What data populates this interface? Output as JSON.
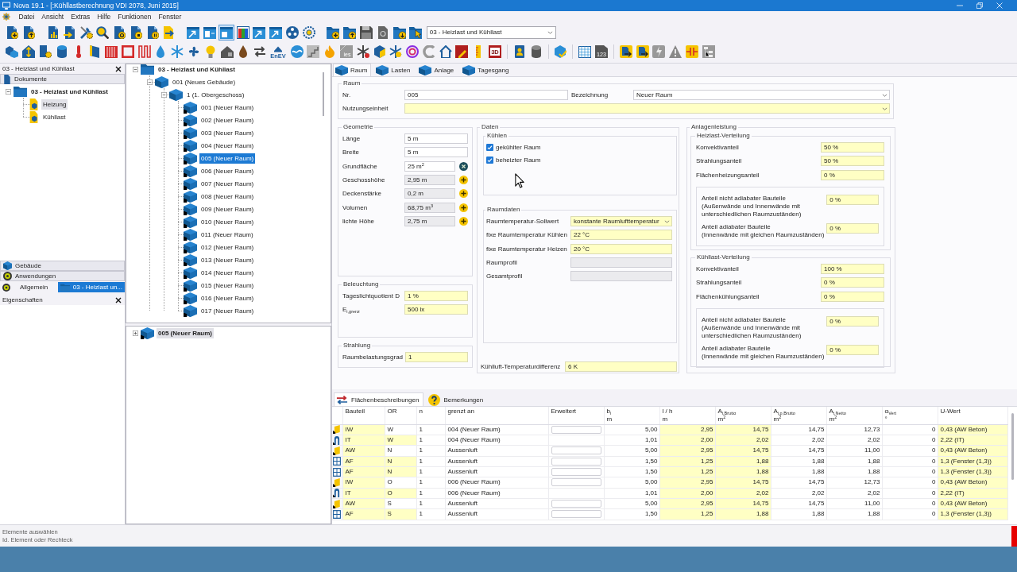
{
  "window": {
    "title": "Nova 19.1 - [:Kühllastberechnung VDI 2078, Juni 2015]"
  },
  "menu": [
    "Datei",
    "Ansicht",
    "Extras",
    "Hilfe",
    "Funktionen",
    "Fenster"
  ],
  "toolbar_1": {
    "buttons": [
      {
        "pressed": false
      },
      {
        "pressed": false
      },
      {
        "pressed": false
      },
      {
        "pressed": false
      },
      {
        "pressed": false
      },
      {
        "pressed": false
      },
      {
        "pressed": false
      },
      {
        "pressed": false
      },
      {
        "pressed": false
      },
      {
        "pressed": false
      },
      {
        "pressed": false
      },
      {
        "pressed": false
      },
      {
        "pressed": true
      },
      {
        "pressed": false
      },
      {
        "pressed": false
      },
      {
        "pressed": false
      },
      {
        "pressed": false
      },
      {
        "pressed": false
      },
      {
        "pressed": false
      },
      {
        "pressed": false
      },
      {
        "pressed": false
      },
      {
        "pressed": false
      },
      {
        "pressed": false
      },
      {
        "pressed": false
      }
    ],
    "dropdown": {
      "value": "03 - Heizlast und Kühllast"
    }
  },
  "toolbar_2": {
    "icon_texts": [
      "EnEV",
      "ies",
      "3D",
      "123"
    ]
  },
  "documents_panel": {
    "title": "03 - Heizlast und Kühllast",
    "section": "Dokumente",
    "tree": [
      {
        "kind": "project",
        "label": "03 - Heizlast und Kühllast",
        "expanded": true,
        "selected": false,
        "children": [
          {
            "kind": "document",
            "label": "Heizung",
            "selected": true
          },
          {
            "kind": "document",
            "label": "Kühllast",
            "selected": false
          }
        ]
      }
    ],
    "sections": [
      "Gebäude",
      "Anwendungen"
    ],
    "tabs": [
      {
        "label": "Allgemein",
        "selected": false
      },
      {
        "label": "03 - Heizlast un...",
        "selected": true
      }
    ]
  },
  "properties_panel": {
    "title": "Eigenschaften"
  },
  "building_tree": [
    {
      "kind": "project",
      "label": "03 - Heizlast und Kühllast",
      "expanded": true,
      "selected": false,
      "children": [
        {
          "kind": "building",
          "label": "001 (Neues Gebäude)",
          "expanded": true,
          "selected": false,
          "children": [
            {
              "kind": "storey",
              "label": "1 (1. Obergeschoss)",
              "expanded": true,
              "selected": false,
              "children": [
                {
                  "kind": "room",
                  "label": "001 (Neuer Raum)",
                  "selected": false
                },
                {
                  "kind": "room",
                  "label": "002 (Neuer Raum)",
                  "selected": false
                },
                {
                  "kind": "room",
                  "label": "003 (Neuer Raum)",
                  "selected": false
                },
                {
                  "kind": "room",
                  "label": "004 (Neuer Raum)",
                  "selected": false
                },
                {
                  "kind": "room",
                  "label": "005 (Neuer Raum)",
                  "selected": true
                },
                {
                  "kind": "room",
                  "label": "006 (Neuer Raum)",
                  "selected": false
                },
                {
                  "kind": "room",
                  "label": "007 (Neuer Raum)",
                  "selected": false
                },
                {
                  "kind": "room",
                  "label": "008 (Neuer Raum)",
                  "selected": false
                },
                {
                  "kind": "room",
                  "label": "009 (Neuer Raum)",
                  "selected": false
                },
                {
                  "kind": "room",
                  "label": "010 (Neuer Raum)",
                  "selected": false
                },
                {
                  "kind": "room",
                  "label": "011 (Neuer Raum)",
                  "selected": false
                },
                {
                  "kind": "room",
                  "label": "012 (Neuer Raum)",
                  "selected": false
                },
                {
                  "kind": "room",
                  "label": "013 (Neuer Raum)",
                  "selected": false
                },
                {
                  "kind": "room",
                  "label": "014 (Neuer Raum)",
                  "selected": false
                },
                {
                  "kind": "room",
                  "label": "015 (Neuer Raum)",
                  "selected": false
                },
                {
                  "kind": "room",
                  "label": "016 (Neuer Raum)",
                  "selected": false
                },
                {
                  "kind": "room",
                  "label": "017 (Neuer Raum)",
                  "selected": false
                }
              ]
            }
          ]
        }
      ]
    }
  ],
  "detail_tree": [
    {
      "kind": "room",
      "label": "005 (Neuer Raum)",
      "expanded": false,
      "selected": true
    }
  ],
  "form_tabs": [
    {
      "label": "Raum",
      "selected": true
    },
    {
      "label": "Lasten",
      "selected": false
    },
    {
      "label": "Anlage",
      "selected": false
    },
    {
      "label": "Tagesgang",
      "selected": false
    }
  ],
  "raum": {
    "title": "Raum",
    "fields": [
      {
        "label": "Nr.",
        "value": "005",
        "kind": "input"
      },
      {
        "label": "Bezeichnung",
        "value": "Neuer Raum",
        "kind": "input",
        "dropdown": true
      },
      {
        "label": "Nutzungseinheit",
        "kind": "highlighted",
        "dropdown": true
      }
    ]
  },
  "geometrie": {
    "title": "Geometrie",
    "fields": [
      {
        "label": "Länge",
        "value": "5 m",
        "kind": "input"
      },
      {
        "label": "Breite",
        "value": "5 m",
        "kind": "input"
      },
      {
        "label": "Grundfläche",
        "value": "25 m$^{2}$",
        "kind": "input",
        "button": {
          "kind": "clear"
        }
      },
      {
        "label": "Geschosshöhe",
        "value": "2,95 m",
        "kind": "readonly",
        "button": {
          "kind": "add"
        }
      },
      {
        "label": "Deckenstärke",
        "value": "0,2 m",
        "kind": "readonly",
        "button": {
          "kind": "add"
        }
      },
      {
        "label": "Volumen",
        "value": "68,75 m$^{3}$",
        "kind": "readonly",
        "button": {
          "kind": "add"
        }
      },
      {
        "label": "lichte Höhe",
        "value": "2,75 m",
        "kind": "readonly",
        "button": {
          "kind": "add"
        }
      }
    ]
  },
  "beleuchtung": {
    "title": "Beleuchtung",
    "fields": [
      {
        "label": "Tageslichtquotient D",
        "value": "1 %",
        "kind": "highlighted"
      },
      {
        "label": "E$_{i,grenz}$",
        "value": "500 lx",
        "kind": "highlighted"
      }
    ]
  },
  "strahlung": {
    "title": "Strahlung",
    "fields": [
      {
        "label": "Raumbelastungsgrad",
        "value": "1",
        "kind": "highlighted"
      }
    ]
  },
  "daten": {
    "title": "Daten",
    "kuehlen": {
      "title": "Kühlen",
      "checkboxes": [
        {
          "label": "gekühlter Raum",
          "checked": true
        },
        {
          "label": "beheizter Raum",
          "checked": true
        }
      ]
    },
    "raumdaten": {
      "title": "Raumdaten",
      "fields": [
        {
          "label": "Raumtemperatur-Sollwert",
          "value": "konstante Raumlufttemperatur",
          "kind": "highlighted",
          "dropdown": true
        },
        {
          "label": "fixe Raumtemperatur Kühlen",
          "value": "22 °C",
          "kind": "highlighted"
        },
        {
          "label": "fixe Raumtemperatur Heizen",
          "value": "20 °C",
          "kind": "highlighted"
        },
        {
          "label": "Raumprofil",
          "kind": "readonly"
        },
        {
          "label": "Gesamtprofil",
          "kind": "readonly"
        }
      ]
    },
    "fields": [
      {
        "label": "Kühlluft-Temperaturdifferenz",
        "value": "6 K",
        "kind": "highlighted"
      }
    ]
  },
  "anlagenleistung": {
    "title": "Anlagenleistung",
    "groups": [
      {
        "title": "Heizlast-Verteilung",
        "fields": [
          {
            "label": "Konvektivanteil",
            "value": "50 %",
            "kind": "highlighted"
          },
          {
            "label": "Strahlungsanteil",
            "value": "50 %",
            "kind": "highlighted"
          },
          {
            "label": "Flächenheizungsanteil",
            "value": "0 %",
            "kind": "highlighted"
          }
        ],
        "shares": [
          {
            "label": "Anteil nicht adiabater Bauteile\n(Außenwände und Innenwände mit\nunterschiedlichen Raumzuständen)",
            "value": "0 %",
            "kind": "highlighted"
          },
          {
            "label": "Anteil adiabater Bauteile\n(Innenwände mit gleichen Raumzuständen)",
            "value": "0 %",
            "kind": "highlighted"
          }
        ]
      },
      {
        "title": "Kühllast-Verteilung",
        "fields": [
          {
            "label": "Konvektivanteil",
            "value": "100 %",
            "kind": "highlighted"
          },
          {
            "label": "Strahlungsanteil",
            "value": "0 %",
            "kind": "highlighted"
          },
          {
            "label": "Flächenkühlungsanteil",
            "value": "0 %",
            "kind": "highlighted"
          }
        ],
        "shares": [
          {
            "label": "Anteil nicht adiabater Bauteile\n(Außenwände und Innenwände mit\nunterschiedlichen Raumzuständen)",
            "value": "0 %",
            "kind": "highlighted"
          },
          {
            "label": "Anteil adiabater Bauteile\n(Innenwände mit gleichen Raumzuständen)",
            "value": "0 %",
            "kind": "highlighted"
          }
        ]
      }
    ]
  },
  "bottom_tabs": [
    {
      "label": "Flächenbeschreibungen",
      "selected": true
    },
    {
      "label": "Bemerkungen",
      "selected": false
    }
  ],
  "surfaces_table": {
    "columns": [
      {
        "label": "Bauteil",
        "kind": "text"
      },
      {
        "label": "OR",
        "kind": "text"
      },
      {
        "label": "n",
        "kind": "text"
      },
      {
        "label": "grenzt an",
        "kind": "text"
      },
      {
        "label": "Erweitert",
        "kind": "box"
      },
      {
        "label": "b$_{i}$",
        "unit": "m",
        "kind": "number"
      },
      {
        "label": "l / h",
        "unit": "m",
        "kind": "number"
      },
      {
        "label": "A$_{i,Brutto}$",
        "unit": "m$^{2}$",
        "kind": "number"
      },
      {
        "label": "A$_{i,p,Brutto}$",
        "unit": "m$^{2}$",
        "kind": "number"
      },
      {
        "label": "A$_{i,Netto}$",
        "unit": "m$^{2}$",
        "kind": "number"
      },
      {
        "label": "α$_{Vert}$",
        "unit": "°",
        "kind": "number"
      },
      {
        "label": "U-Wert",
        "kind": "text"
      }
    ],
    "rows": [
      {
        "kind": "wall",
        "cells": [
          {
            "text": "IW",
            "highlighted": true
          },
          {
            "text": "W",
            "highlighted": false
          },
          {
            "text": "1",
            "highlighted": false
          },
          {
            "text": "004 (Neuer Raum)",
            "highlighted": false
          },
          {
            "box": true
          },
          {
            "text": "5,00",
            "highlighted": false
          },
          {
            "text": "2,95",
            "highlighted": true
          },
          {
            "text": "14,75",
            "highlighted": true
          },
          {
            "text": "14,75",
            "highlighted": false
          },
          {
            "text": "12,73",
            "highlighted": false
          },
          {
            "text": "0",
            "highlighted": false
          },
          {
            "text": "0,43 (AW Beton)",
            "highlighted": true
          }
        ]
      },
      {
        "kind": "door",
        "cells": [
          {
            "text": "IT",
            "highlighted": true
          },
          {
            "text": "W",
            "highlighted": true
          },
          {
            "text": "1",
            "highlighted": false
          },
          {
            "text": "004 (Neuer Raum)",
            "highlighted": false
          },
          {
            "box": false
          },
          {
            "text": "1,01",
            "highlighted": false
          },
          {
            "text": "2,00",
            "highlighted": true
          },
          {
            "text": "2,02",
            "highlighted": true
          },
          {
            "text": "2,02",
            "highlighted": false
          },
          {
            "text": "2,02",
            "highlighted": false
          },
          {
            "text": "0",
            "highlighted": false
          },
          {
            "text": "2,22 (IT)",
            "highlighted": true
          }
        ]
      },
      {
        "kind": "wall",
        "cells": [
          {
            "text": "AW",
            "highlighted": true
          },
          {
            "text": "N",
            "highlighted": false
          },
          {
            "text": "1",
            "highlighted": false
          },
          {
            "text": "Aussenluft",
            "highlighted": false
          },
          {
            "box": true
          },
          {
            "text": "5,00",
            "highlighted": false
          },
          {
            "text": "2,95",
            "highlighted": true
          },
          {
            "text": "14,75",
            "highlighted": true
          },
          {
            "text": "14,75",
            "highlighted": false
          },
          {
            "text": "11,00",
            "highlighted": false
          },
          {
            "text": "0",
            "highlighted": false
          },
          {
            "text": "0,43 (AW Beton)",
            "highlighted": true
          }
        ]
      },
      {
        "kind": "window",
        "cells": [
          {
            "text": "AF",
            "highlighted": true
          },
          {
            "text": "N",
            "highlighted": true
          },
          {
            "text": "1",
            "highlighted": false
          },
          {
            "text": "Aussenluft",
            "highlighted": false
          },
          {
            "box": true
          },
          {
            "text": "1,50",
            "highlighted": false
          },
          {
            "text": "1,25",
            "highlighted": true
          },
          {
            "text": "1,88",
            "highlighted": true
          },
          {
            "text": "1,88",
            "highlighted": false
          },
          {
            "text": "1,88",
            "highlighted": false
          },
          {
            "text": "0",
            "highlighted": false
          },
          {
            "text": "1,3 (Fenster (1,3))",
            "highlighted": true
          }
        ]
      },
      {
        "kind": "window",
        "cells": [
          {
            "text": "AF",
            "highlighted": true
          },
          {
            "text": "N",
            "highlighted": true
          },
          {
            "text": "1",
            "highlighted": false
          },
          {
            "text": "Aussenluft",
            "highlighted": false
          },
          {
            "box": true
          },
          {
            "text": "1,50",
            "highlighted": false
          },
          {
            "text": "1,25",
            "highlighted": true
          },
          {
            "text": "1,88",
            "highlighted": true
          },
          {
            "text": "1,88",
            "highlighted": false
          },
          {
            "text": "1,88",
            "highlighted": false
          },
          {
            "text": "0",
            "highlighted": false
          },
          {
            "text": "1,3 (Fenster (1,3))",
            "highlighted": true
          }
        ]
      },
      {
        "kind": "wall",
        "cells": [
          {
            "text": "IW",
            "highlighted": true
          },
          {
            "text": "O",
            "highlighted": false
          },
          {
            "text": "1",
            "highlighted": false
          },
          {
            "text": "006 (Neuer Raum)",
            "highlighted": false
          },
          {
            "box": true
          },
          {
            "text": "5,00",
            "highlighted": false
          },
          {
            "text": "2,95",
            "highlighted": true
          },
          {
            "text": "14,75",
            "highlighted": true
          },
          {
            "text": "14,75",
            "highlighted": false
          },
          {
            "text": "12,73",
            "highlighted": false
          },
          {
            "text": "0",
            "highlighted": false
          },
          {
            "text": "0,43 (AW Beton)",
            "highlighted": true
          }
        ]
      },
      {
        "kind": "door",
        "cells": [
          {
            "text": "IT",
            "highlighted": true
          },
          {
            "text": "O",
            "highlighted": true
          },
          {
            "text": "1",
            "highlighted": false
          },
          {
            "text": "006 (Neuer Raum)",
            "highlighted": false
          },
          {
            "box": false
          },
          {
            "text": "1,01",
            "highlighted": false
          },
          {
            "text": "2,00",
            "highlighted": true
          },
          {
            "text": "2,02",
            "highlighted": true
          },
          {
            "text": "2,02",
            "highlighted": false
          },
          {
            "text": "2,02",
            "highlighted": false
          },
          {
            "text": "0",
            "highlighted": false
          },
          {
            "text": "2,22 (IT)",
            "highlighted": true
          }
        ]
      },
      {
        "kind": "wall",
        "cells": [
          {
            "text": "AW",
            "highlighted": true
          },
          {
            "text": "S",
            "highlighted": false
          },
          {
            "text": "1",
            "highlighted": false
          },
          {
            "text": "Aussenluft",
            "highlighted": false
          },
          {
            "box": true
          },
          {
            "text": "5,00",
            "highlighted": false
          },
          {
            "text": "2,95",
            "highlighted": true
          },
          {
            "text": "14,75",
            "highlighted": true
          },
          {
            "text": "14,75",
            "highlighted": false
          },
          {
            "text": "11,00",
            "highlighted": false
          },
          {
            "text": "0",
            "highlighted": false
          },
          {
            "text": "0,43 (AW Beton)",
            "highlighted": true
          }
        ]
      },
      {
        "kind": "window",
        "cells": [
          {
            "text": "AF",
            "highlighted": true
          },
          {
            "text": "S",
            "highlighted": true
          },
          {
            "text": "1",
            "highlighted": false
          },
          {
            "text": "Aussenluft",
            "highlighted": false
          },
          {
            "box": true
          },
          {
            "text": "1,50",
            "highlighted": false
          },
          {
            "text": "1,25",
            "highlighted": true
          },
          {
            "text": "1,88",
            "highlighted": true
          },
          {
            "text": "1,88",
            "highlighted": false
          },
          {
            "text": "1,88",
            "highlighted": false
          },
          {
            "text": "0",
            "highlighted": false
          },
          {
            "text": "1,3 (Fenster (1,3))",
            "highlighted": true
          }
        ]
      }
    ]
  },
  "status_bar": {
    "lines": [
      "Elemente auswählen",
      "Id. Element oder Rechteck"
    ]
  }
}
